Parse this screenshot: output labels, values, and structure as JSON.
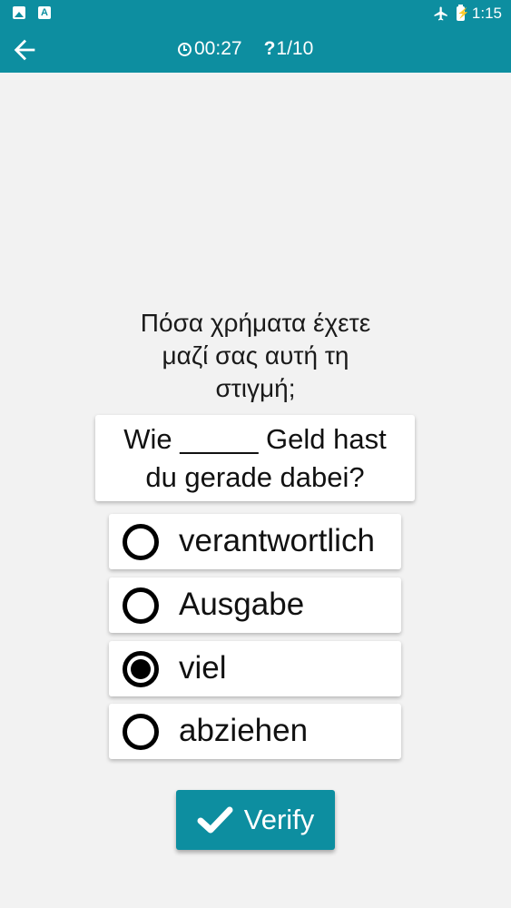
{
  "status_bar": {
    "time": "1:15",
    "icons": [
      "image-icon",
      "a-icon",
      "airplane-icon",
      "battery-icon"
    ]
  },
  "header": {
    "timer": "00:27",
    "progress": "1/10"
  },
  "question": {
    "lines": [
      "Πόσα χρήματα έχετε",
      "μαζί σας αυτή τη",
      "στιγμή;"
    ],
    "prompt_lines": [
      "Wie _____ Geld hast",
      "du gerade dabei?"
    ]
  },
  "options": [
    {
      "label": "verantwortlich",
      "selected": false
    },
    {
      "label": "Ausgabe",
      "selected": false
    },
    {
      "label": "viel",
      "selected": true
    },
    {
      "label": "abziehen",
      "selected": false
    }
  ],
  "verify_label": "Verify",
  "colors": {
    "accent": "#0d8ea0",
    "background": "#f2f2f2"
  }
}
